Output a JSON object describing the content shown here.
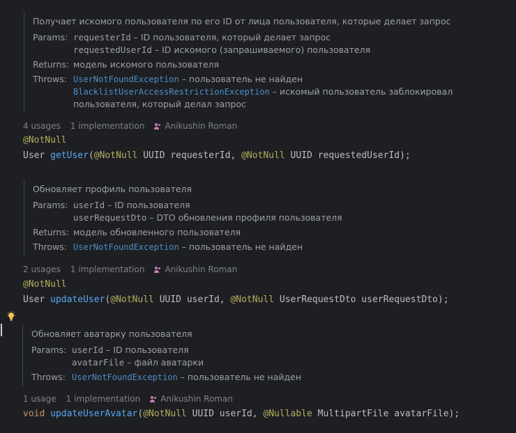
{
  "methods": [
    {
      "doc": {
        "summary": "Получает искомого пользователя по его ID от лица пользователя, которые делает запрос",
        "params_label": "Params:",
        "params": [
          {
            "name": "requesterId",
            "desc": " – ID пользователя, который делает запрос"
          },
          {
            "name": "requestedUserId",
            "desc": " – ID искомого (запрашиваемого) пользователя"
          }
        ],
        "returns_label": "Returns:",
        "returns": "модель искомого пользователя",
        "throws_label": "Throws:",
        "throws": [
          {
            "name": "UserNotFoundException",
            "desc": " – пользователь не найден"
          },
          {
            "name": "BlacklistUserAccessRestrictionException",
            "desc": " – искомый пользователь заблокировал",
            "cont": "пользователя, который делал запрос"
          }
        ]
      },
      "hints": {
        "usages": "4 usages",
        "impl": "1 implementation",
        "author": "Anikushin Roman"
      },
      "annotation": "@NotNull",
      "code": {
        "ret": "User ",
        "name": "getUser",
        "a1": "@NotNull",
        "t1": " UUID requesterId, ",
        "a2": "@NotNull",
        "t2": " UUID requestedUserId);"
      }
    },
    {
      "doc": {
        "summary": "Обновляет профиль пользователя",
        "params_label": "Params:",
        "params": [
          {
            "name": "userId",
            "desc": " – ID пользователя"
          },
          {
            "name": "userRequestDto",
            "desc": " – DTO обновления профиля пользователя"
          }
        ],
        "returns_label": "Returns:",
        "returns": "модель обновленного пользователя",
        "throws_label": "Throws:",
        "throws": [
          {
            "name": "UserNotFoundException",
            "desc": " – пользователь не найден"
          }
        ]
      },
      "hints": {
        "usages": "2 usages",
        "impl": "1 implementation",
        "author": "Anikushin Roman"
      },
      "annotation": "@NotNull",
      "code": {
        "ret": "User ",
        "name": "updateUser",
        "a1": "@NotNull",
        "t1": " UUID userId, ",
        "a2": "@NotNull",
        "t2": " UserRequestDto userRequestDto);"
      }
    },
    {
      "doc": {
        "summary": "Обновляет аватарку пользователя",
        "params_label": "Params:",
        "params": [
          {
            "name": "userId",
            "desc": " – ID пользователя"
          },
          {
            "name": "avatarFile",
            "desc": " – файл аватарки"
          }
        ],
        "throws_label": "Throws:",
        "throws": [
          {
            "name": "UserNotFoundException",
            "desc": " – пользователь не найден"
          }
        ]
      },
      "hints": {
        "usages": "1 usage",
        "impl": "1 implementation",
        "author": "Anikushin Roman"
      },
      "code": {
        "ret": "void",
        "name": "updateUserAvatar",
        "a1": "@NotNull",
        "t1": " UUID userId, ",
        "a2": "@Nullable",
        "t2": " MultipartFile avatarFile);"
      }
    }
  ],
  "icons": {
    "intention": "lightbulb-icon",
    "author": "user-group-icon"
  },
  "colors": {
    "background": "#1e1f22",
    "annotation": "#b3ae60",
    "function": "#56a8f5",
    "keyword": "#cf8e6d",
    "link": "#4c8dc9",
    "author_icon": "#c77dbb"
  }
}
